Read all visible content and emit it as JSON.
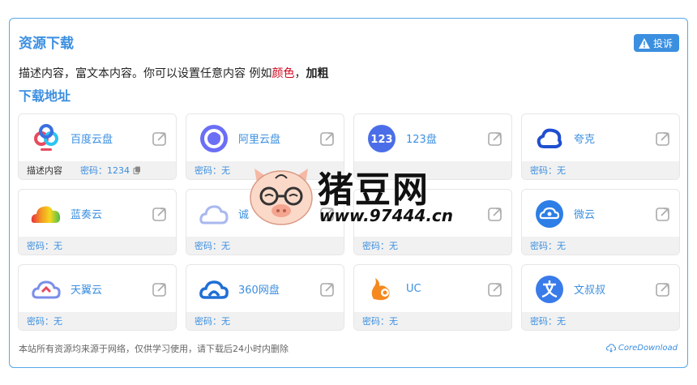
{
  "panel": {
    "title": "资源下载",
    "report_label": "投诉",
    "desc_prefix": "描述内容，富文本内容。你可以设置任意内容 例如",
    "desc_red": "颜色",
    "desc_sep": "，",
    "desc_bold": "加粗",
    "subtitle": "下载地址"
  },
  "cards": [
    {
      "name": "百度云盘",
      "note": "描述内容",
      "pwd": "密码：1234",
      "icon": "baidu-netdisk-icon"
    },
    {
      "name": "阿里云盘",
      "pwd": "密码：无",
      "icon": "aliyun-drive-icon"
    },
    {
      "name": "123盘",
      "pwd": "",
      "icon": "123pan-icon"
    },
    {
      "name": "夸克",
      "pwd": "密码：无",
      "icon": "quark-icon"
    },
    {
      "name": "蓝奏云",
      "pwd": "密码：无",
      "icon": "lanzou-icon"
    },
    {
      "name": "诚",
      "pwd": "密码：无",
      "icon": "cloud-icon"
    },
    {
      "name": "",
      "pwd": "密码：无",
      "icon": "cloud-icon"
    },
    {
      "name": "微云",
      "pwd": "密码：无",
      "icon": "weiyun-icon"
    },
    {
      "name": "天翼云",
      "pwd": "密码：无",
      "icon": "tianyi-cloud-icon"
    },
    {
      "name": "360网盘",
      "pwd": "密码：无",
      "icon": "360-pan-icon"
    },
    {
      "name": "UC",
      "pwd": "密码：无",
      "icon": "uc-icon"
    },
    {
      "name": "文叔叔",
      "pwd": "密码：无",
      "icon": "wenshushu-icon"
    }
  ],
  "footer": {
    "notice": "本站所有资源均来源于网络，仅供学习使用，请下载后24小时内删除",
    "brand": "CoreDownload"
  },
  "watermark": {
    "text": "猪豆网",
    "url": "www.97444.cn"
  },
  "colors": {
    "accent": "#3b8fe0",
    "red": "#d0021b"
  }
}
